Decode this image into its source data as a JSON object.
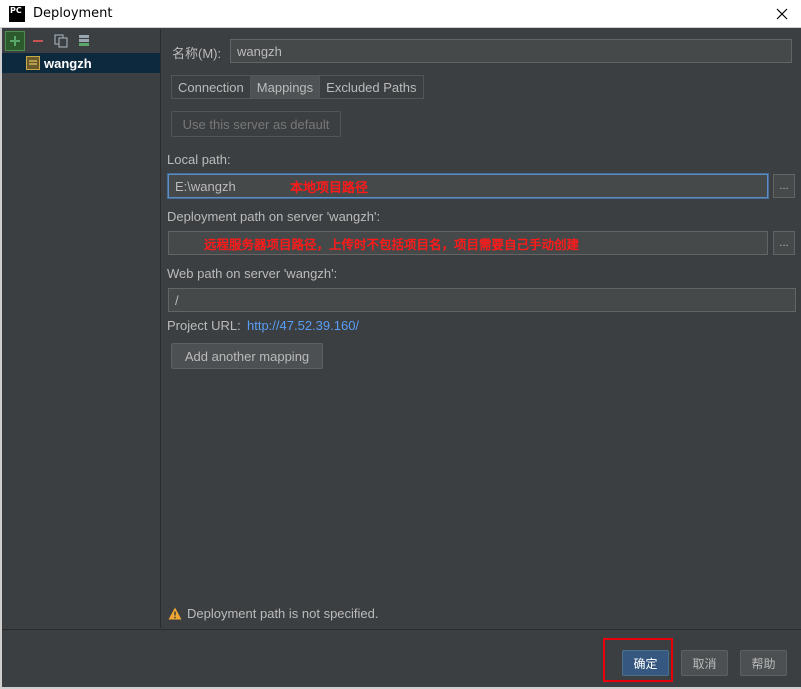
{
  "window": {
    "title": "Deployment",
    "logo_text": "PC"
  },
  "sidebar": {
    "selected_server": "wangzh"
  },
  "form": {
    "name_label": "名称(M):",
    "name_value": "wangzh",
    "tabs": [
      {
        "label": "Connection"
      },
      {
        "label": "Mappings"
      },
      {
        "label": "Excluded Paths"
      }
    ],
    "use_default_label": "Use this server as default",
    "local_path_label": "Local path:",
    "local_path_value": "E:\\wangzh",
    "local_path_annotation": "本地项目路径",
    "deployment_path_label": "Deployment path on server 'wangzh':",
    "deployment_path_value": "",
    "deployment_path_annotation": "远程服务器项目路径，上传时不包括项目名，项目需要自己手动创建",
    "web_path_label": "Web path on server 'wangzh':",
    "web_path_value": "/",
    "project_url_label": "Project URL:",
    "project_url_value": "http://47.52.39.160/",
    "add_mapping_label": "Add another mapping",
    "browse_label": "...",
    "warning_text": "Deployment path is not specified."
  },
  "buttons": {
    "ok": "确定",
    "cancel": "取消",
    "help": "帮助"
  },
  "colors": {
    "accent": "#365880",
    "link": "#589df6",
    "annotation": "#ff1a1a",
    "highlight": "#e8000b"
  }
}
